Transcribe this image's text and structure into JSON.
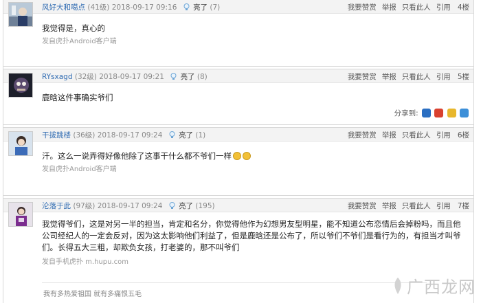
{
  "actions": {
    "like": "我要赞赏",
    "report": "举报",
    "only_this": "只看此人",
    "quote": "引用"
  },
  "light_label": "亮了",
  "share_label": "分享到:",
  "posts": [
    {
      "username": "风好大和噶点",
      "level": "(41级)",
      "time": "2018-09-17 09:16",
      "light_count": "(7)",
      "floor": "4楼",
      "content": "我觉得是，真心的",
      "source": "发自虎扑Android客户端"
    },
    {
      "username": "RYsxagd",
      "level": "(32级)",
      "time": "2018-09-17 09:21",
      "light_count": "(8)",
      "floor": "5楼",
      "content": "鹿晗这件事确实爷们"
    },
    {
      "username": "干拔跳楼",
      "level": "(36级)",
      "time": "2018-09-17 09:24",
      "light_count": "(1)",
      "floor": "6楼",
      "content": "汗。这么一说弄得好像他除了这事干什么都不爷们一样",
      "source": "发自虎扑Android客户端"
    },
    {
      "username": "沦落于此",
      "level": "(97级)",
      "time": "2018-09-17 09:24",
      "light_count": "(195)",
      "floor": "7楼",
      "content": "我觉得爷们，这是对另一半的担当，肯定和名分，你觉得他作为幻想男友型明星，能不知道公布恋情后会掉粉吗，而且他公司经纪人的一定会反对，因为这太影响他们利益了，但是鹿晗还是公布了，所以爷们不爷们是看行为的，有担当才叫爷们。长得五大三粗，却欺负女孩，打老婆的，那不叫爷们",
      "source": "发自手机虎扑 m.hupu.com",
      "signature": "我有多热爱祖国 就有多痛恨五毛"
    }
  ],
  "watermark": "广西龙网",
  "colors": {
    "username": "#2f6bb2",
    "header_bg": "#f3f3f3",
    "border": "#d7d7d7"
  }
}
